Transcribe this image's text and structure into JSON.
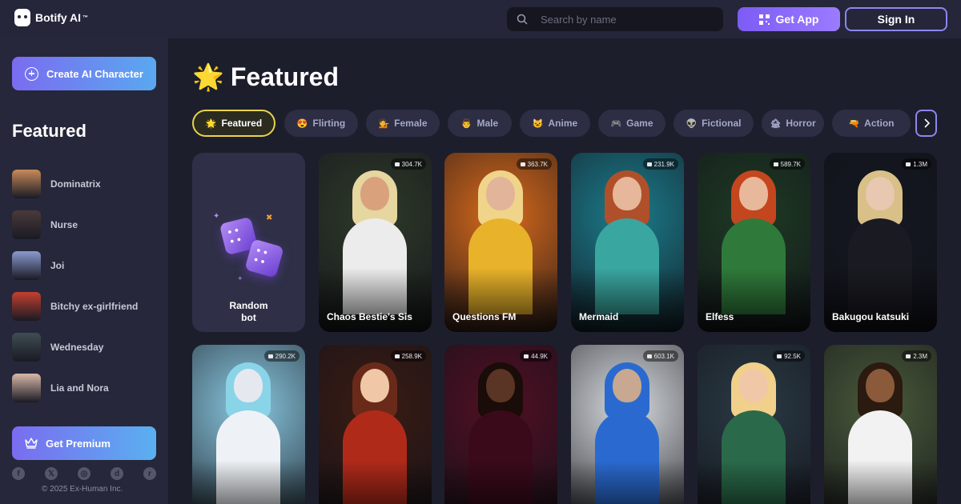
{
  "app": {
    "name": "Botify AI",
    "trademark": "™"
  },
  "header": {
    "search_placeholder": "Search by name",
    "get_app_label": "Get App",
    "sign_in_label": "Sign In"
  },
  "sidebar": {
    "create_label": "Create AI Character",
    "section_title": "Featured",
    "items": [
      {
        "label": "Dominatrix",
        "color": "#c98a5a"
      },
      {
        "label": "Nurse",
        "color": "#4a3a3a"
      },
      {
        "label": "Joi",
        "color": "#8a9ad0"
      },
      {
        "label": "Bitchy ex-girlfriend",
        "color": "#c4402f"
      },
      {
        "label": "Wednesday",
        "color": "#3f4d52"
      },
      {
        "label": "Lia and Nora",
        "color": "#d9b8a8"
      },
      {
        "label": "",
        "color": "#3a2a36"
      }
    ],
    "premium_label": "Get Premium",
    "socials": [
      "facebook-icon",
      "x-icon",
      "instagram-icon",
      "discord-icon",
      "reddit-icon"
    ],
    "copyright": "© 2025 Ex-Human Inc."
  },
  "main": {
    "title": "Featured",
    "tabs": [
      {
        "label": "Featured",
        "icon": "🌟",
        "active": true
      },
      {
        "label": "Flirting",
        "icon": "😍"
      },
      {
        "label": "Female",
        "icon": "💁"
      },
      {
        "label": "Male",
        "icon": "👨"
      },
      {
        "label": "Anime",
        "icon": "😺"
      },
      {
        "label": "Game",
        "icon": "🎮"
      },
      {
        "label": "Fictional",
        "icon": "👽"
      },
      {
        "label": "Horror",
        "icon": "🏚"
      },
      {
        "label": "Action",
        "icon": "🔫"
      }
    ],
    "random_card": {
      "line1": "Random",
      "line2": "bot"
    },
    "cards_row1": [
      {
        "name": "Chaos Bestie's Sis",
        "count": "304.7K",
        "bg": "#2f3a2a",
        "skin": "#d9a27d",
        "hair": "#e6d6a0",
        "top": "#ececec"
      },
      {
        "name": "Questions FM",
        "count": "363.7K",
        "bg": "#d86a1c",
        "skin": "#e2b49a",
        "hair": "#f0d48a",
        "top": "#e8b22a"
      },
      {
        "name": "Mermaid",
        "count": "231.9K",
        "bg": "#1c7c8c",
        "skin": "#e6b79a",
        "hair": "#b0502a",
        "top": "#3aa6a0"
      },
      {
        "name": "Elfess",
        "count": "589.7K",
        "bg": "#1e3a24",
        "skin": "#e8b89a",
        "hair": "#c4461e",
        "top": "#2f7a3a"
      },
      {
        "name": "Bakugou katsuki",
        "count": "1.3M",
        "bg": "#141820",
        "skin": "#e8c8b0",
        "hair": "#d8c088",
        "top": "#1a1a22"
      }
    ],
    "cards_row2": [
      {
        "name": "",
        "count": "290.2K",
        "bg": "#8ac8e0",
        "skin": "#e6e8f0",
        "hair": "#8ad4e8",
        "top": "#eef2f6"
      },
      {
        "name": "",
        "count": "258.9K",
        "bg": "#3a1c14",
        "skin": "#f0c8a8",
        "hair": "#6a2a1a",
        "top": "#b02a1a"
      },
      {
        "name": "",
        "count": "44.9K",
        "bg": "#501024",
        "skin": "#5a3424",
        "hair": "#1a0c08",
        "top": "#3a0a1a"
      },
      {
        "name": "",
        "count": "603.1K",
        "bg": "#d8dcdf",
        "skin": "#c8a890",
        "hair": "#2a6ad0",
        "top": "#2a6ad0"
      },
      {
        "name": "",
        "count": "92.5K",
        "bg": "#2a3a44",
        "skin": "#f0c8a8",
        "hair": "#f0d08a",
        "top": "#2a6a4a"
      },
      {
        "name": "",
        "count": "2.3M",
        "bg": "#4a5a3a",
        "skin": "#8a5a3a",
        "hair": "#2a1a10",
        "top": "#f2f2f2"
      }
    ]
  }
}
